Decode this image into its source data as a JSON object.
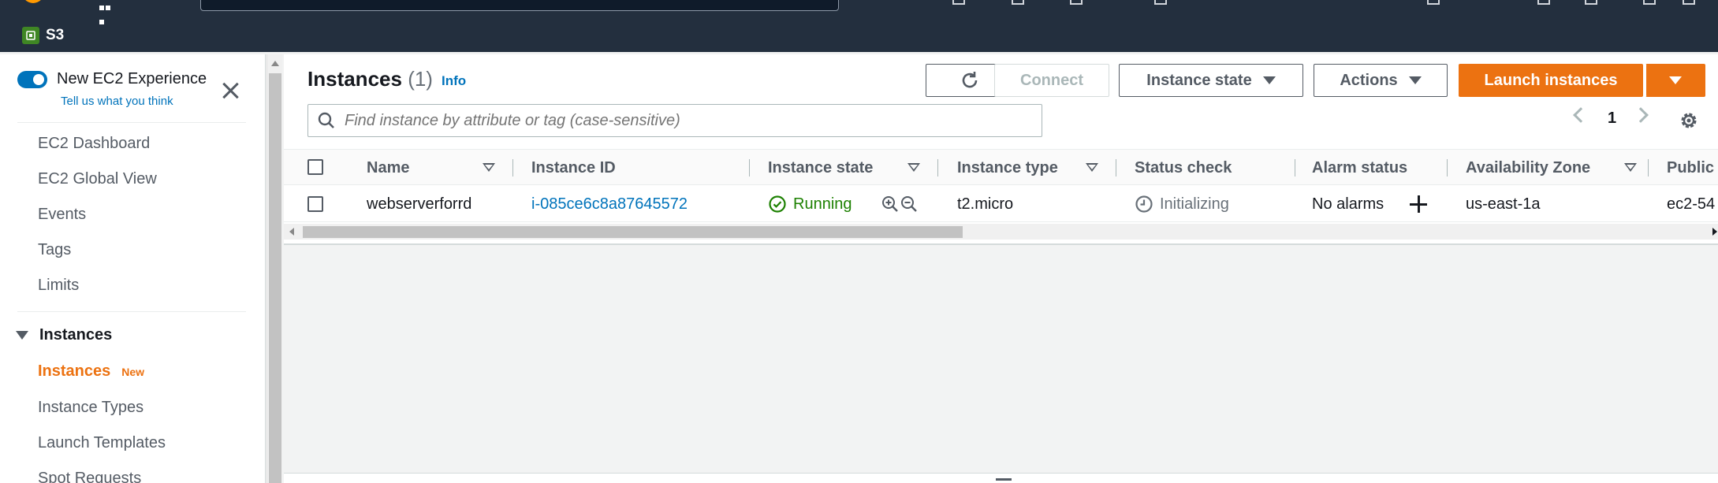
{
  "header": {
    "favorites": [
      {
        "label": "S3"
      }
    ]
  },
  "sidebar": {
    "toggle_label": "New EC2 Experience",
    "toggle_on": true,
    "feedback_link": "Tell us what you think",
    "items": [
      {
        "label": "EC2 Dashboard"
      },
      {
        "label": "EC2 Global View"
      },
      {
        "label": "Events"
      },
      {
        "label": "Tags"
      },
      {
        "label": "Limits"
      }
    ],
    "section": {
      "label": "Instances",
      "items": [
        {
          "label": "Instances",
          "badge": "New",
          "active": true
        },
        {
          "label": "Instance Types"
        },
        {
          "label": "Launch Templates"
        },
        {
          "label": "Spot Requests"
        }
      ]
    }
  },
  "main": {
    "title": "Instances",
    "count": "(1)",
    "info_link": "Info",
    "buttons": {
      "connect": "Connect",
      "instance_state": "Instance state",
      "actions": "Actions",
      "launch": "Launch instances"
    },
    "search": {
      "placeholder": "Find instance by attribute or tag (case-sensitive)"
    },
    "pagination": {
      "page": "1"
    },
    "table": {
      "columns": [
        {
          "label": "Name"
        },
        {
          "label": "Instance ID"
        },
        {
          "label": "Instance state"
        },
        {
          "label": "Instance type"
        },
        {
          "label": "Status check"
        },
        {
          "label": "Alarm status"
        },
        {
          "label": "Availability Zone"
        },
        {
          "label": "Public"
        }
      ],
      "rows": [
        {
          "name": "webserverforrd",
          "instance_id": "i-085ce6c8a87645572",
          "state": "Running",
          "type": "t2.micro",
          "status_check": "Initializing",
          "alarm_status": "No alarms",
          "zone": "us-east-1a",
          "public": "ec2-54"
        }
      ]
    }
  },
  "colors": {
    "header_bg": "#232f3e",
    "accent_orange": "#ec7211",
    "link_blue": "#0073bb",
    "running_green": "#1d8102"
  },
  "icons": [
    "aws-logo",
    "apps-grid-icon",
    "s3-bucket-icon",
    "close-icon",
    "refresh-icon",
    "search-icon",
    "chevron-left-icon",
    "chevron-right-icon",
    "settings-gear-icon",
    "check-circle-icon",
    "zoom-in-icon",
    "zoom-out-icon",
    "clock-icon",
    "plus-icon",
    "caret-down-icon"
  ]
}
